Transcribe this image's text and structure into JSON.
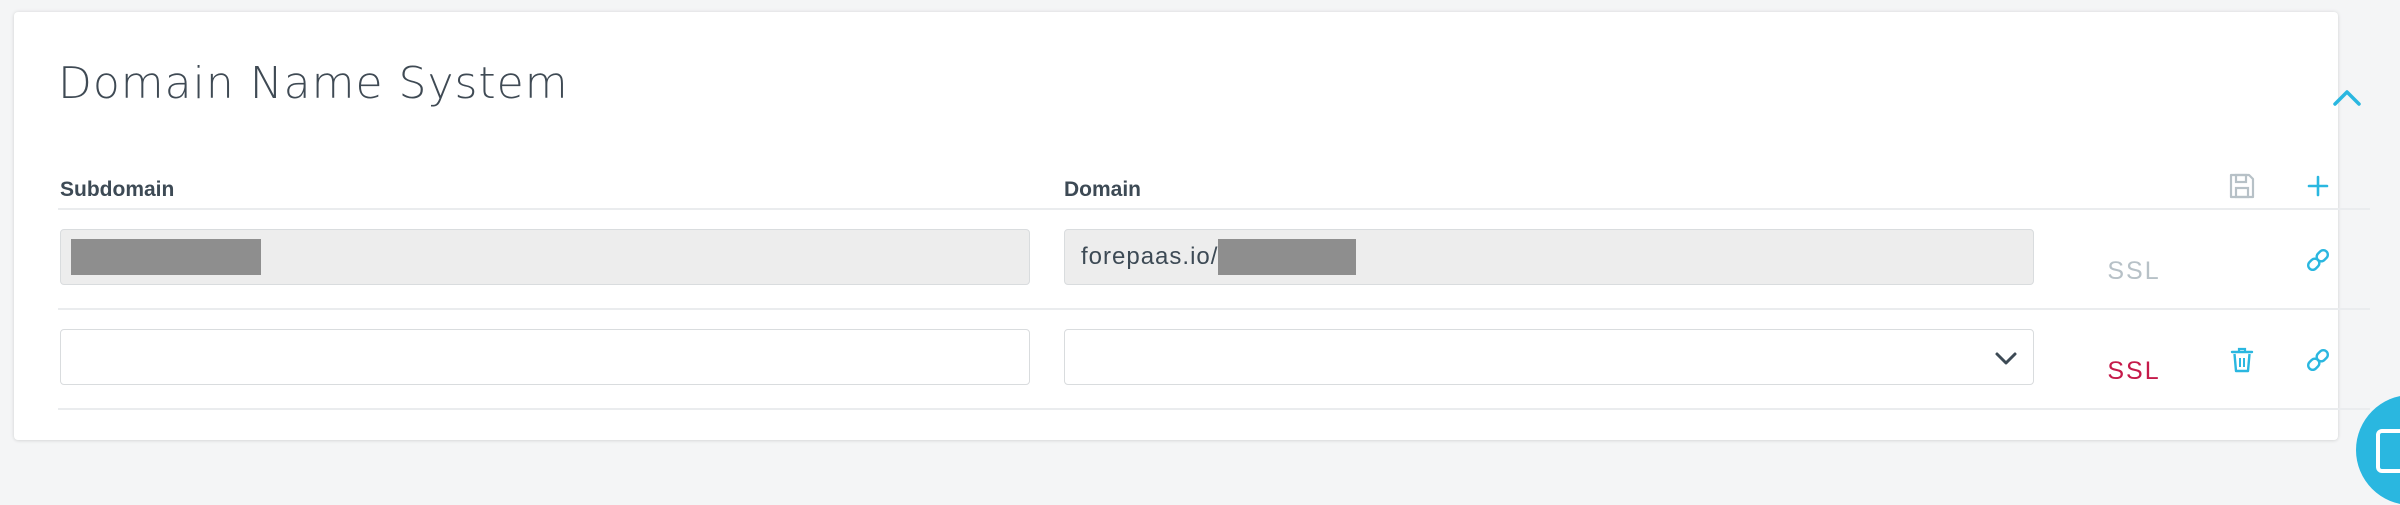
{
  "section": {
    "title": "Domain Name System"
  },
  "table": {
    "columns": {
      "subdomain": "Subdomain",
      "domain": "Domain"
    },
    "rows": [
      {
        "subdomain_value": "",
        "domain_prefix": "forepaas.io/",
        "ssl_label": "SSL",
        "ssl_state": "disabled"
      },
      {
        "subdomain_value": "",
        "domain_selected": "",
        "ssl_label": "SSL",
        "ssl_state": "enabled"
      }
    ]
  },
  "colors": {
    "accent": "#2ab7e0",
    "ssl_disabled": "#b7c1c7",
    "ssl_enabled": "#c51a4a",
    "text": "#3d4a55"
  },
  "icons": {
    "collapse": "chevron-up-icon",
    "save": "save-icon",
    "add": "plus-icon",
    "delete": "trash-icon",
    "link": "link-icon",
    "dropdown": "chevron-down-icon",
    "chat": "chat-icon"
  }
}
